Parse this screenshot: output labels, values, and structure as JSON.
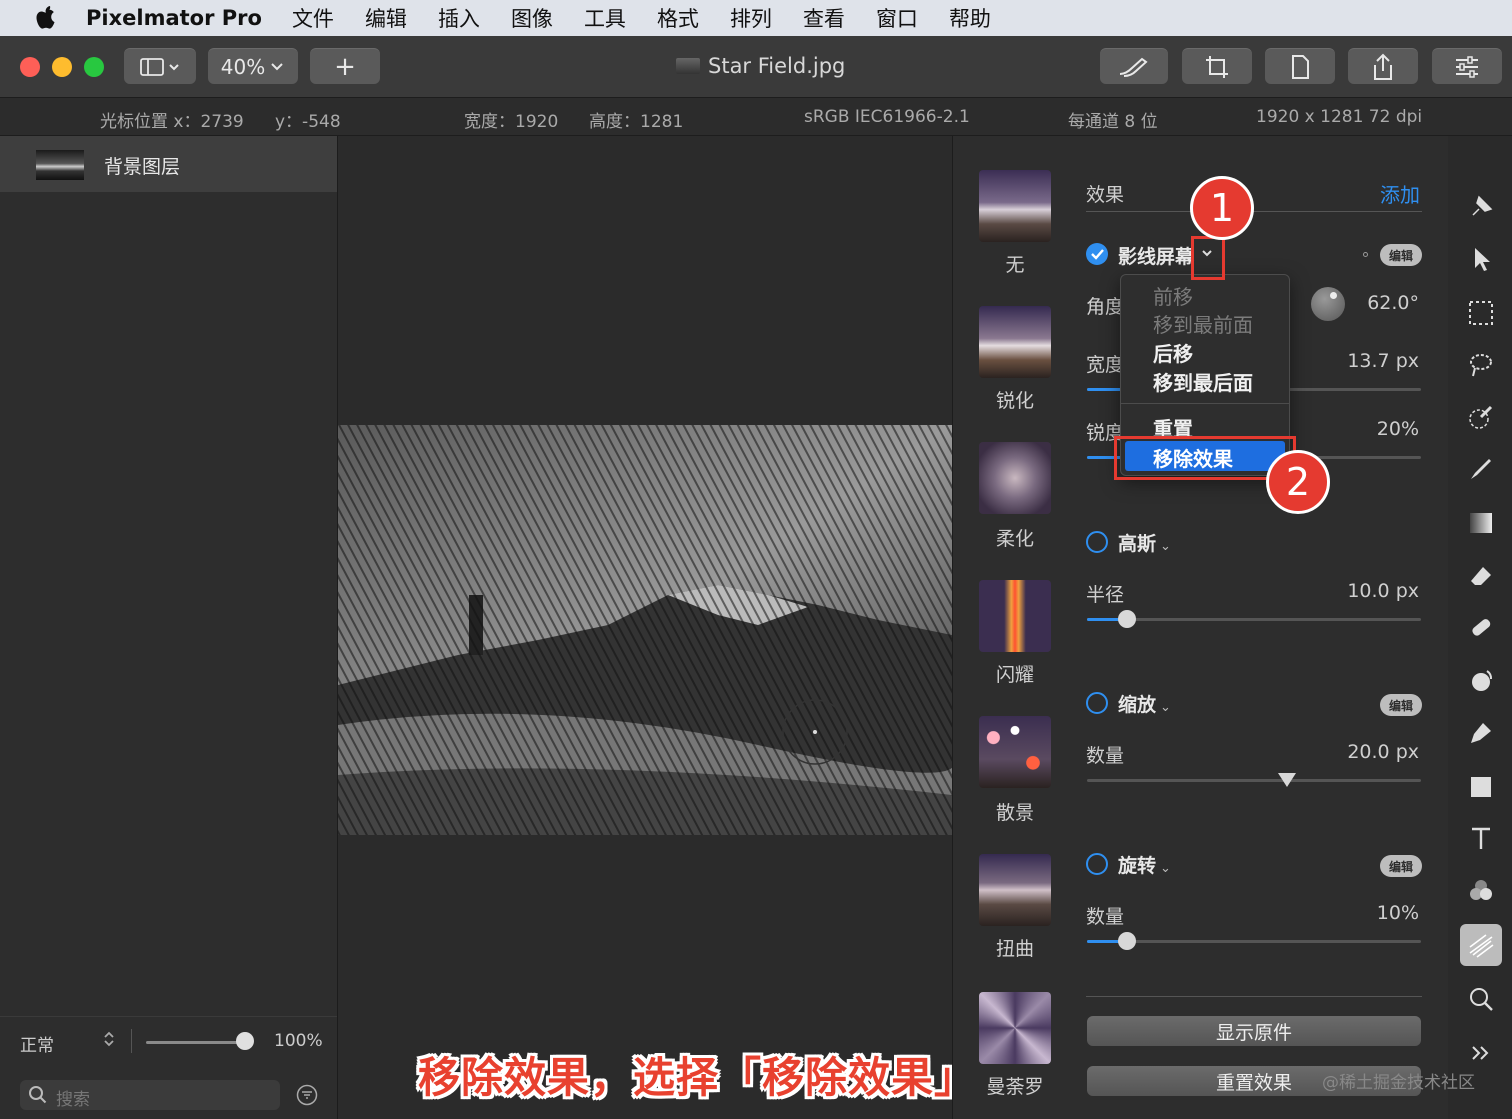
{
  "menubar": {
    "app_name": "Pixelmator Pro",
    "items": [
      "文件",
      "编辑",
      "插入",
      "图像",
      "工具",
      "格式",
      "排列",
      "查看",
      "窗口",
      "帮助"
    ]
  },
  "toolbar": {
    "zoom": "40%",
    "add_label": "+",
    "document_title": "Star Field.jpg"
  },
  "infobar": {
    "cursor_x": "光标位置 x：2739",
    "cursor_y": "y：-548",
    "width": "宽度：1920",
    "height": "高度：1281",
    "color_profile": "sRGB IEC61966-2.1",
    "bit_depth": "每通道 8 位",
    "dimensions": "1920 x 1281 72 dpi"
  },
  "layers": {
    "items": [
      {
        "name": "背景图层"
      }
    ],
    "blend_mode": "正常",
    "opacity": "100%",
    "opacity_fraction": 1.0,
    "search_placeholder": "搜索"
  },
  "effects": {
    "title": "效果",
    "add_label": "添加",
    "presets": [
      "无",
      "锐化",
      "柔化",
      "闪耀",
      "散景",
      "扭曲",
      "曼荼罗"
    ],
    "edit_label": "编辑",
    "halftone": {
      "name": "影线屏幕",
      "enabled": true,
      "angle_label": "角度",
      "angle_value": "62.0°",
      "width_label": "宽度",
      "width_value": "13.7 px",
      "width_fraction": 0.12,
      "sharp_label": "锐度",
      "sharp_value": "20%",
      "sharp_fraction": 0.2
    },
    "gaussian": {
      "name": "高斯",
      "enabled": false,
      "radius_label": "半径",
      "radius_value": "10.0 px",
      "radius_fraction": 0.12
    },
    "zoom": {
      "name": "缩放",
      "enabled": false,
      "amount_label": "数量",
      "amount_value": "20.0 px",
      "amount_fraction": 0.6
    },
    "spin": {
      "name": "旋转",
      "enabled": false,
      "amount_label": "数量",
      "amount_value": "10%",
      "amount_fraction": 0.12
    },
    "show_original_label": "显示原件",
    "reset_label": "重置效果"
  },
  "dropdown": {
    "items": [
      "前移",
      "移到最前面",
      "后移",
      "移到最后面",
      "重置",
      "移除效果"
    ],
    "disabled": [
      true,
      true,
      false,
      false,
      false,
      false
    ],
    "highlighted": "移除效果"
  },
  "annotations": {
    "step1": "1",
    "step2": "2",
    "caption": "移除效果，选择「移除效果」",
    "watermark": "@稀土掘金技术社区",
    "color": "#e53a30"
  },
  "colors": {
    "accent": "#2f8ff0",
    "highlight": "#1e6ee0",
    "annotation_red": "#e53a30"
  }
}
